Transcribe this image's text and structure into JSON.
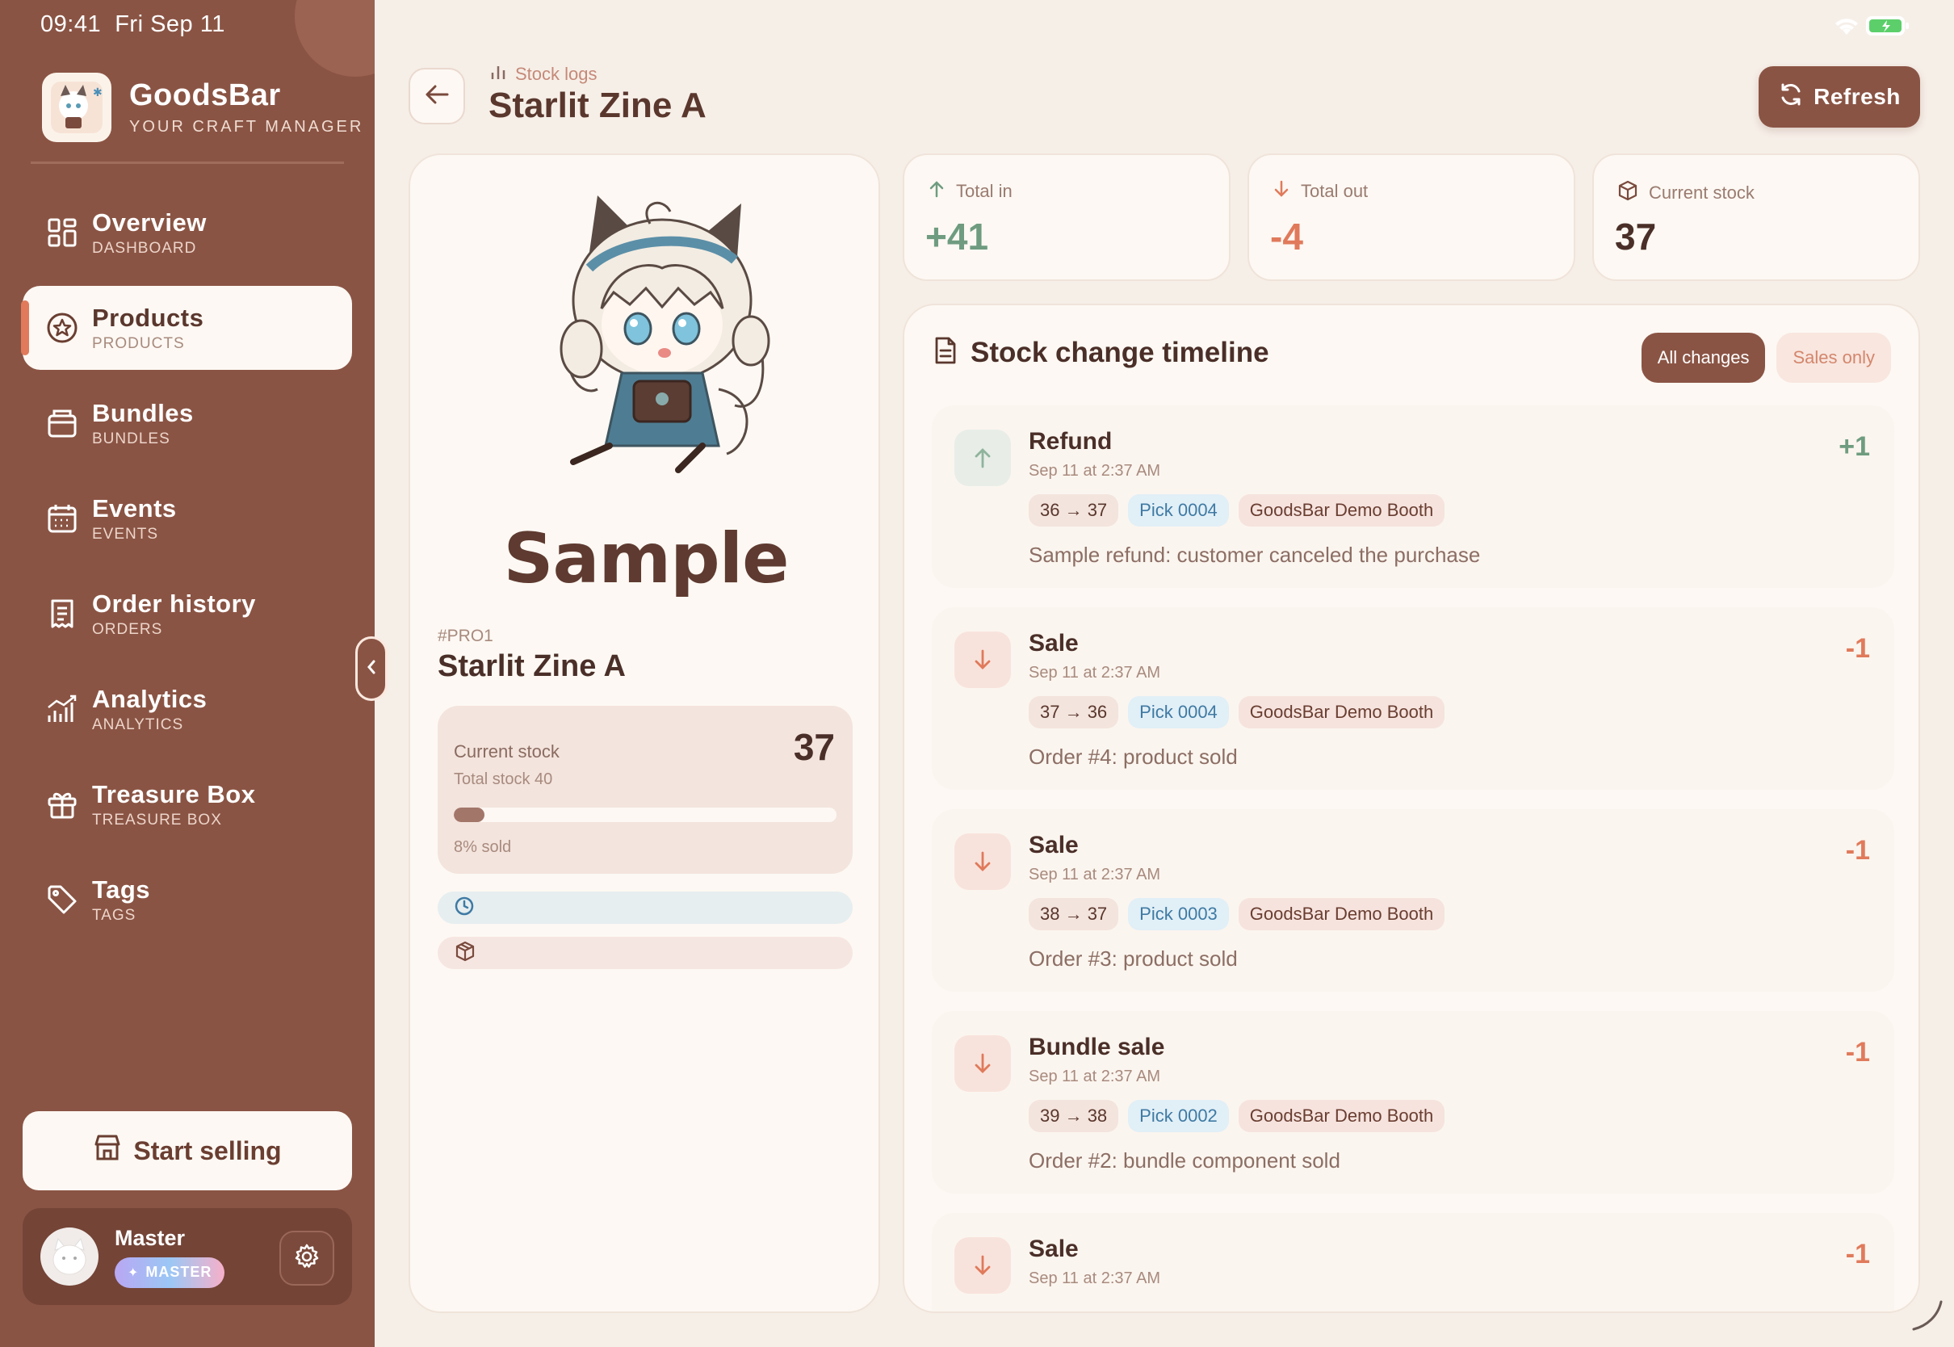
{
  "status_bar": {
    "time": "09:41",
    "date": "Fri Sep 11"
  },
  "brand": {
    "name": "GoodsBar",
    "tagline": "YOUR CRAFT MANAGER"
  },
  "nav": [
    {
      "label": "Overview",
      "sub": "DASHBOARD",
      "icon": "grid-icon",
      "active": false
    },
    {
      "label": "Products",
      "sub": "PRODUCTS",
      "icon": "star-circle-icon",
      "active": true
    },
    {
      "label": "Bundles",
      "sub": "BUNDLES",
      "icon": "box-icon",
      "active": false
    },
    {
      "label": "Events",
      "sub": "EVENTS",
      "icon": "calendar-icon",
      "active": false
    },
    {
      "label": "Order history",
      "sub": "ORDERS",
      "icon": "receipt-icon",
      "active": false
    },
    {
      "label": "Analytics",
      "sub": "ANALYTICS",
      "icon": "chart-icon",
      "active": false
    },
    {
      "label": "Treasure Box",
      "sub": "TREASURE BOX",
      "icon": "gift-icon",
      "active": false
    },
    {
      "label": "Tags",
      "sub": "TAGS",
      "icon": "tag-icon",
      "active": false
    }
  ],
  "start_selling": "Start selling",
  "user": {
    "name": "Master",
    "badge": "MASTER"
  },
  "header": {
    "breadcrumb": "Stock logs",
    "title": "Starlit Zine A",
    "refresh": "Refresh"
  },
  "product": {
    "image_text": "Sample",
    "code": "#PRO1",
    "name": "Starlit Zine A",
    "current_stock_label": "Current stock",
    "current_stock": "37",
    "total_stock": "Total stock 40",
    "sold_fraction": 0.08,
    "sold_text": "8% sold"
  },
  "stats": {
    "total_in": {
      "label": "Total in",
      "value": "+41"
    },
    "total_out": {
      "label": "Total out",
      "value": "-4"
    },
    "current": {
      "label": "Current stock",
      "value": "37"
    }
  },
  "timeline": {
    "title": "Stock change timeline",
    "filter_all": "All changes",
    "filter_sales": "Sales only",
    "entries": [
      {
        "title": "Refund",
        "time": "Sep 11 at 2:37 AM",
        "delta": "+1",
        "direction": "up",
        "range": "36 → 37",
        "pick": "Pick 0004",
        "booth": "GoodsBar Demo Booth",
        "note": "Sample refund: customer canceled the purchase"
      },
      {
        "title": "Sale",
        "time": "Sep 11 at 2:37 AM",
        "delta": "-1",
        "direction": "down",
        "range": "37 → 36",
        "pick": "Pick 0004",
        "booth": "GoodsBar Demo Booth",
        "note": "Order #4: product sold"
      },
      {
        "title": "Sale",
        "time": "Sep 11 at 2:37 AM",
        "delta": "-1",
        "direction": "down",
        "range": "38 → 37",
        "pick": "Pick 0003",
        "booth": "GoodsBar Demo Booth",
        "note": "Order #3: product sold"
      },
      {
        "title": "Bundle sale",
        "time": "Sep 11 at 2:37 AM",
        "delta": "-1",
        "direction": "down",
        "range": "39 → 38",
        "pick": "Pick 0002",
        "booth": "GoodsBar Demo Booth",
        "note": "Order #2: bundle component sold"
      },
      {
        "title": "Sale",
        "time": "Sep 11 at 2:37 AM",
        "delta": "-1",
        "direction": "down",
        "range": "",
        "pick": "",
        "booth": "",
        "note": ""
      }
    ]
  },
  "colors": {
    "sidebar": "#8a5444",
    "accent": "#e07a5b",
    "positive": "#6f9c80",
    "background": "#f6efe8"
  }
}
